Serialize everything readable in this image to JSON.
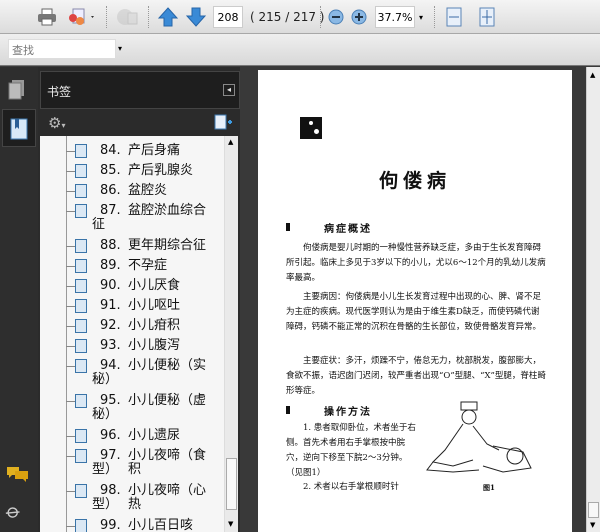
{
  "toolbar": {
    "page_number": "208",
    "page_count": "( 215 / 217 )",
    "zoom": "37.7%"
  },
  "find": {
    "placeholder": "查找"
  },
  "panel": {
    "title": "书签"
  },
  "bookmarks": [
    {
      "num": "84.",
      "text": "产后身痛"
    },
    {
      "num": "85.",
      "text": "产后乳腺炎"
    },
    {
      "num": "86.",
      "text": "盆腔炎"
    },
    {
      "num": "87.",
      "text": "盆腔淤血综合",
      "wrap": "征"
    },
    {
      "num": "88.",
      "text": "更年期综合征"
    },
    {
      "num": "89.",
      "text": "不孕症"
    },
    {
      "num": "90.",
      "text": "小儿厌食"
    },
    {
      "num": "91.",
      "text": "小儿呕吐"
    },
    {
      "num": "92.",
      "text": "小儿疳积"
    },
    {
      "num": "93.",
      "text": "小儿腹泻"
    },
    {
      "num": "94.",
      "text": "小儿便秘（实",
      "wrap": "秘）"
    },
    {
      "num": "95.",
      "text": "小儿便秘（虚",
      "wrap": "秘）"
    },
    {
      "num": "96.",
      "text": "小儿遗尿"
    },
    {
      "num": "97.",
      "text": "小儿夜啼（食积",
      "wrap": "型）"
    },
    {
      "num": "98.",
      "text": "小儿夜啼（心热",
      "wrap": "型）"
    },
    {
      "num": "99.",
      "text": "小儿百日咳"
    }
  ],
  "document": {
    "title": "佝偻病",
    "section1": "病症概述",
    "para1": "佝偻病是婴儿时期的一种慢性营养缺乏症，多由于生长发育障碍所引起。临床上多见于3岁以下的小儿，尤以6～12个月的乳幼儿发病率最高。",
    "para2": "主要病因：佝偻病是小儿生长发育过程中出现的心、脾、肾不足为主症的疾病。现代医学则认为是由于维生素D缺乏，而使钙磷代谢障碍，钙磷不能正常的沉积在骨骼的生长部位，致使骨骼发育异常。",
    "para3": "主要症状：多汗，烦躁不宁，倦怠无力，枕部脱发，腹部膨大，食欲不振，语迟囱门迟闭，较严重者出现“O”型腿、“X”型腿，脊柱畸形等症。",
    "section2": "操作方法",
    "step1": "1. 患者取仰卧位，术者坐于右侧。首先术者用右手掌根按中脘穴，逆向下移至下脘2～3分钟。（见图1）",
    "step2": "2. 术者以右手掌根顺时针",
    "figure_caption": "图1"
  }
}
